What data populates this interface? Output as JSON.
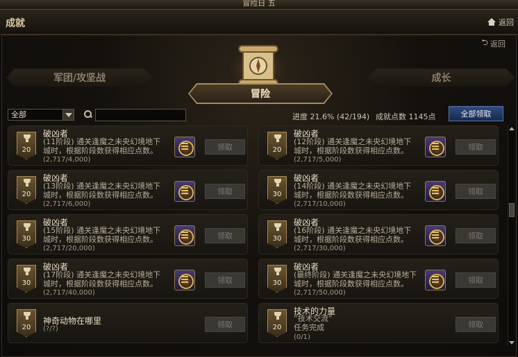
{
  "window": {
    "title": "冒险日 五"
  },
  "header": {
    "page_title": "成就",
    "back_label": "返回"
  },
  "sub_back_label": "返回",
  "tabs": {
    "left": "军团/攻坚战",
    "active": "冒险",
    "right": "成长"
  },
  "filter": {
    "selected": "全部",
    "search_placeholder": ""
  },
  "stats": {
    "progress_text": "进度  21.6% (42/194)",
    "points_text": "成就点数 1145点"
  },
  "claim_all_label": "全部领取",
  "achievements": [
    {
      "points": "20",
      "name": "破凶者",
      "desc": "(11阶段) 通关逢魔之未央幻境地下城时，根据阶段数获得相应点数。",
      "progress": "(2,717/4,000)",
      "claim": "领取"
    },
    {
      "points": "20",
      "name": "破凶者",
      "desc": "(12阶段) 通关逢魔之未央幻境地下城时，根据阶段数获得相应点数。",
      "progress": "(2,717/5,000)",
      "claim": "领取"
    },
    {
      "points": "20",
      "name": "破凶者",
      "desc": "(13阶段) 通关逢魔之未央幻境地下城时，根据阶段数获得相应点数。",
      "progress": "(2,717/6,000)",
      "claim": "领取"
    },
    {
      "points": "30",
      "name": "破凶者",
      "desc": "(14阶段) 通关逢魔之未央幻境地下城时，根据阶段数获得相应点数。",
      "progress": "(2,717/10,000)",
      "claim": "领取"
    },
    {
      "points": "30",
      "name": "破凶者",
      "desc": "(15阶段) 通关逢魔之未央幻境地下城时，根据阶段数获得相应点数。",
      "progress": "(2,717/20,000)",
      "claim": "领取"
    },
    {
      "points": "30",
      "name": "破凶者",
      "desc": "(16阶段) 通关逢魔之未央幻境地下城时，根据阶段数获得相应点数。",
      "progress": "(2,717/30,000)",
      "claim": "领取"
    },
    {
      "points": "30",
      "name": "破凶者",
      "desc": "(17阶段) 通关逢魔之未央幻境地下城时，根据阶段数获得相应点数。",
      "progress": "(2,717/40,000)",
      "claim": "领取"
    },
    {
      "points": "30",
      "name": "破凶者",
      "desc": "(最终阶段) 通关逢魔之未央幻境地下城时，根据阶段数获得相应点数。",
      "progress": "(2,717/50,000)",
      "claim": "领取"
    },
    {
      "points": "20",
      "name": "神奇动物在哪里",
      "desc": "",
      "progress": "(?/?)",
      "claim": "领取"
    },
    {
      "points": "20",
      "name": "技术的力量",
      "desc": "“技术交流”\n任务完成",
      "progress": "(0/1)",
      "claim": "领取"
    }
  ]
}
